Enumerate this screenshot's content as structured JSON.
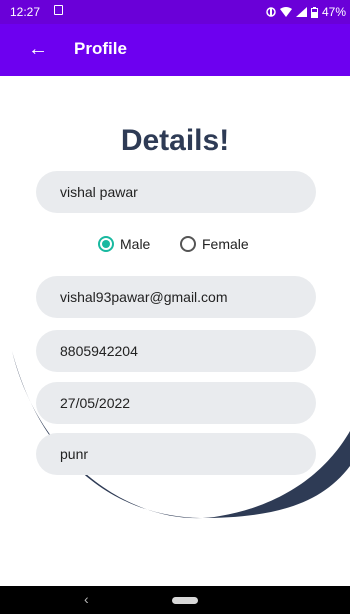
{
  "status_bar": {
    "time": "12:27",
    "battery": "47%"
  },
  "app_bar": {
    "title": "Profile",
    "back_icon": "arrow-back-icon"
  },
  "heading": "Details!",
  "form": {
    "name": "vishal pawar",
    "gender_options": [
      {
        "label": "Male",
        "selected": true
      },
      {
        "label": "Female",
        "selected": false
      }
    ],
    "email": "vishal93pawar@gmail.com",
    "phone": "8805942204",
    "date": "27/05/2022",
    "city": "punr"
  },
  "colors": {
    "status_bar": "#6a00d8",
    "app_bar": "#6d00f0",
    "heading": "#2e3b55",
    "background_shape": "#2e3b55",
    "field_bg": "#e9ebee",
    "radio_accent": "#19b9a0"
  }
}
